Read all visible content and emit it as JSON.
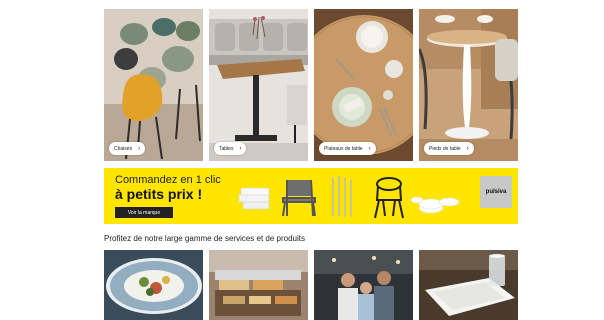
{
  "categories": [
    {
      "label": "Chaises",
      "arrow": "›",
      "image": "chairs-photo"
    },
    {
      "label": "Tables",
      "arrow": "›",
      "image": "tables-photo"
    },
    {
      "label": "Plateaux de table",
      "arrow": "›",
      "image": "table-tops-photo"
    },
    {
      "label": "Pieds de table",
      "arrow": "›",
      "image": "table-legs-photo"
    }
  ],
  "promo": {
    "line1": "Commandez en 1 clic",
    "line2": "à petits prix !",
    "button_label": "Voir la marque",
    "brand": "pulsiva",
    "background": "#ffe500"
  },
  "services": {
    "title": "Profitez de notre large gamme de services et de produits",
    "tiles": [
      {
        "image": "plated-food-photo"
      },
      {
        "image": "buffet-photo"
      },
      {
        "image": "team-meeting-photo"
      },
      {
        "image": "glassware-napkin-photo"
      }
    ]
  }
}
